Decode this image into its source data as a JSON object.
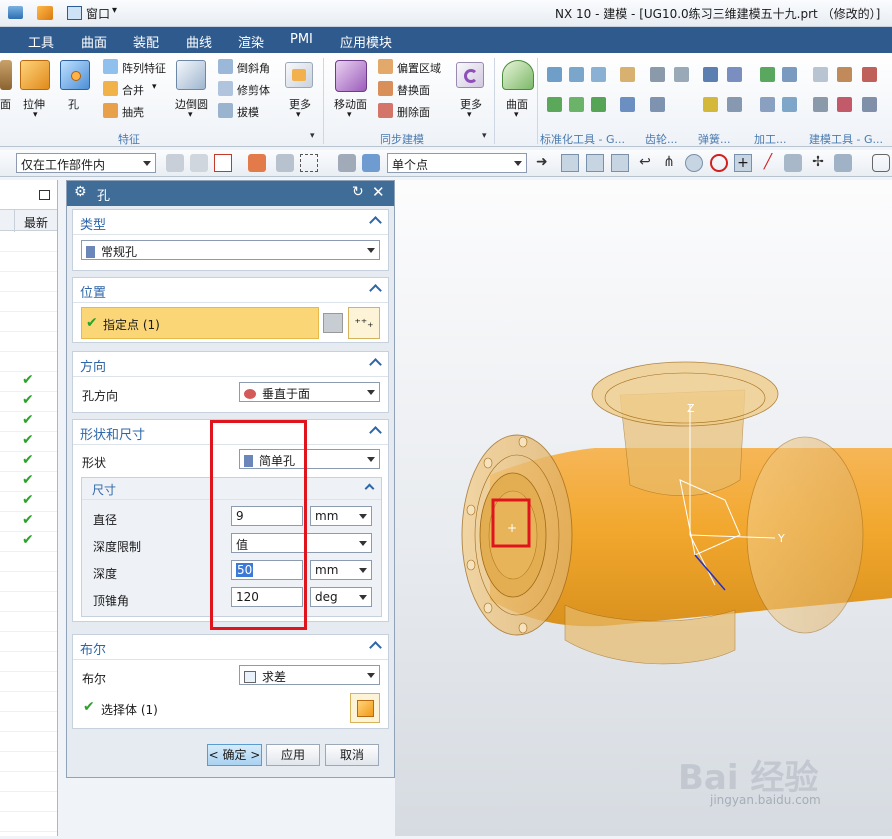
{
  "titlebar": {
    "window_menu": "窗口",
    "title": "NX 10 - 建模 - [UG10.0练习三维建模五十九.prt （修改的）]"
  },
  "menubar": [
    "工具",
    "曲面",
    "装配",
    "曲线",
    "渲染",
    "PMI",
    "应用模块"
  ],
  "ribbon": {
    "labels": [
      "阵列特征",
      "合并",
      "抽壳",
      "倒斜角",
      "修剪体",
      "拔模",
      "偏置区域",
      "替换面",
      "删除面"
    ],
    "big_labels": [
      "面",
      "拉伸",
      "孔",
      "边倒圆",
      "更多",
      "移动面",
      "更多",
      "曲面"
    ],
    "groups": [
      "特征",
      "同步建模",
      "标准化工具 - G...",
      "齿轮...",
      "弹簧...",
      "加工...",
      "建模工具 - G..."
    ]
  },
  "selbar": {
    "filter": "仅在工作部件内",
    "snap": "单个点"
  },
  "nav": {
    "col_latest": "最新",
    "checks": 9
  },
  "dialog": {
    "title": "孔",
    "sections": {
      "type": "类型",
      "position": "位置",
      "direction": "方向",
      "shape": "形状和尺寸",
      "dims": "尺寸",
      "boolean": "布尔"
    },
    "type_value": "常规孔",
    "specify_point": "指定点 (1)",
    "hole_dir_label": "孔方向",
    "hole_dir_value": "垂直于面",
    "shape_label": "形状",
    "shape_value": "简单孔",
    "diameter_label": "直径",
    "diameter_value": "9",
    "diameter_unit": "mm",
    "depth_limit_label": "深度限制",
    "depth_limit_value": "值",
    "depth_label": "深度",
    "depth_value": "50",
    "depth_unit": "mm",
    "tip_label": "顶锥角",
    "tip_value": "120",
    "tip_unit": "deg",
    "bool_label": "布尔",
    "bool_value": "求差",
    "select_body": "选择体 (1)",
    "ok": "< 确定 >",
    "apply": "应用",
    "cancel": "取消"
  },
  "viewport": {
    "axis_z": "Z",
    "axis_y": "Y",
    "watermark": "Bai 经验",
    "watermark_url": "jingyan.baidu.com"
  }
}
